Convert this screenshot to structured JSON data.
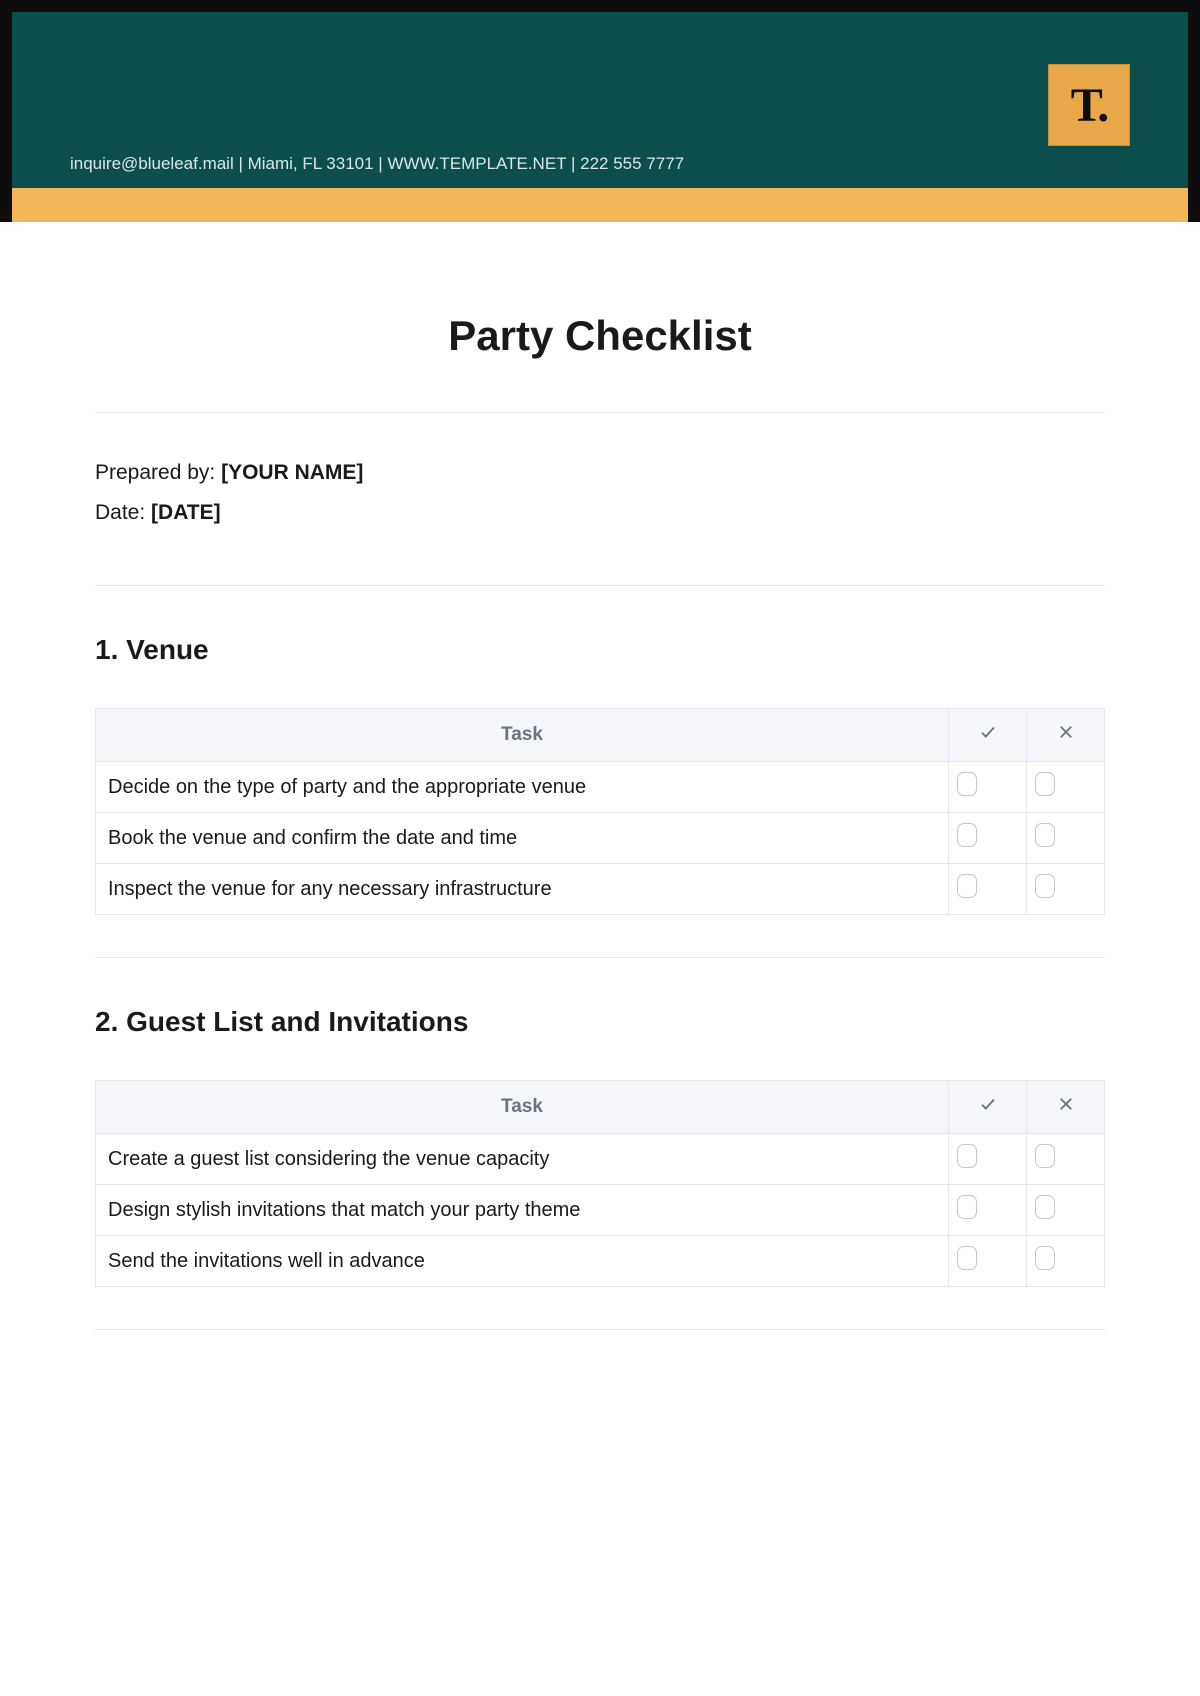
{
  "header": {
    "contact": "inquire@blueleaf.mail | Miami, FL 33101 | WWW.TEMPLATE.NET | 222 555 7777",
    "logo": "T."
  },
  "title": "Party Checklist",
  "meta": {
    "prepared_by_label": "Prepared by: ",
    "prepared_by_value": "[YOUR NAME]",
    "date_label": "Date: ",
    "date_value": "[DATE]"
  },
  "table_headers": {
    "task": "Task"
  },
  "sections": [
    {
      "heading": "1. Venue",
      "tasks": [
        "Decide on the type of party and the appropriate venue",
        "Book the venue and confirm the date and time",
        "Inspect the venue for any necessary infrastructure"
      ]
    },
    {
      "heading": "2. Guest List and Invitations",
      "tasks": [
        "Create a guest list considering the venue capacity",
        "Design stylish invitations that match your party theme",
        "Send the invitations well in advance"
      ]
    }
  ]
}
